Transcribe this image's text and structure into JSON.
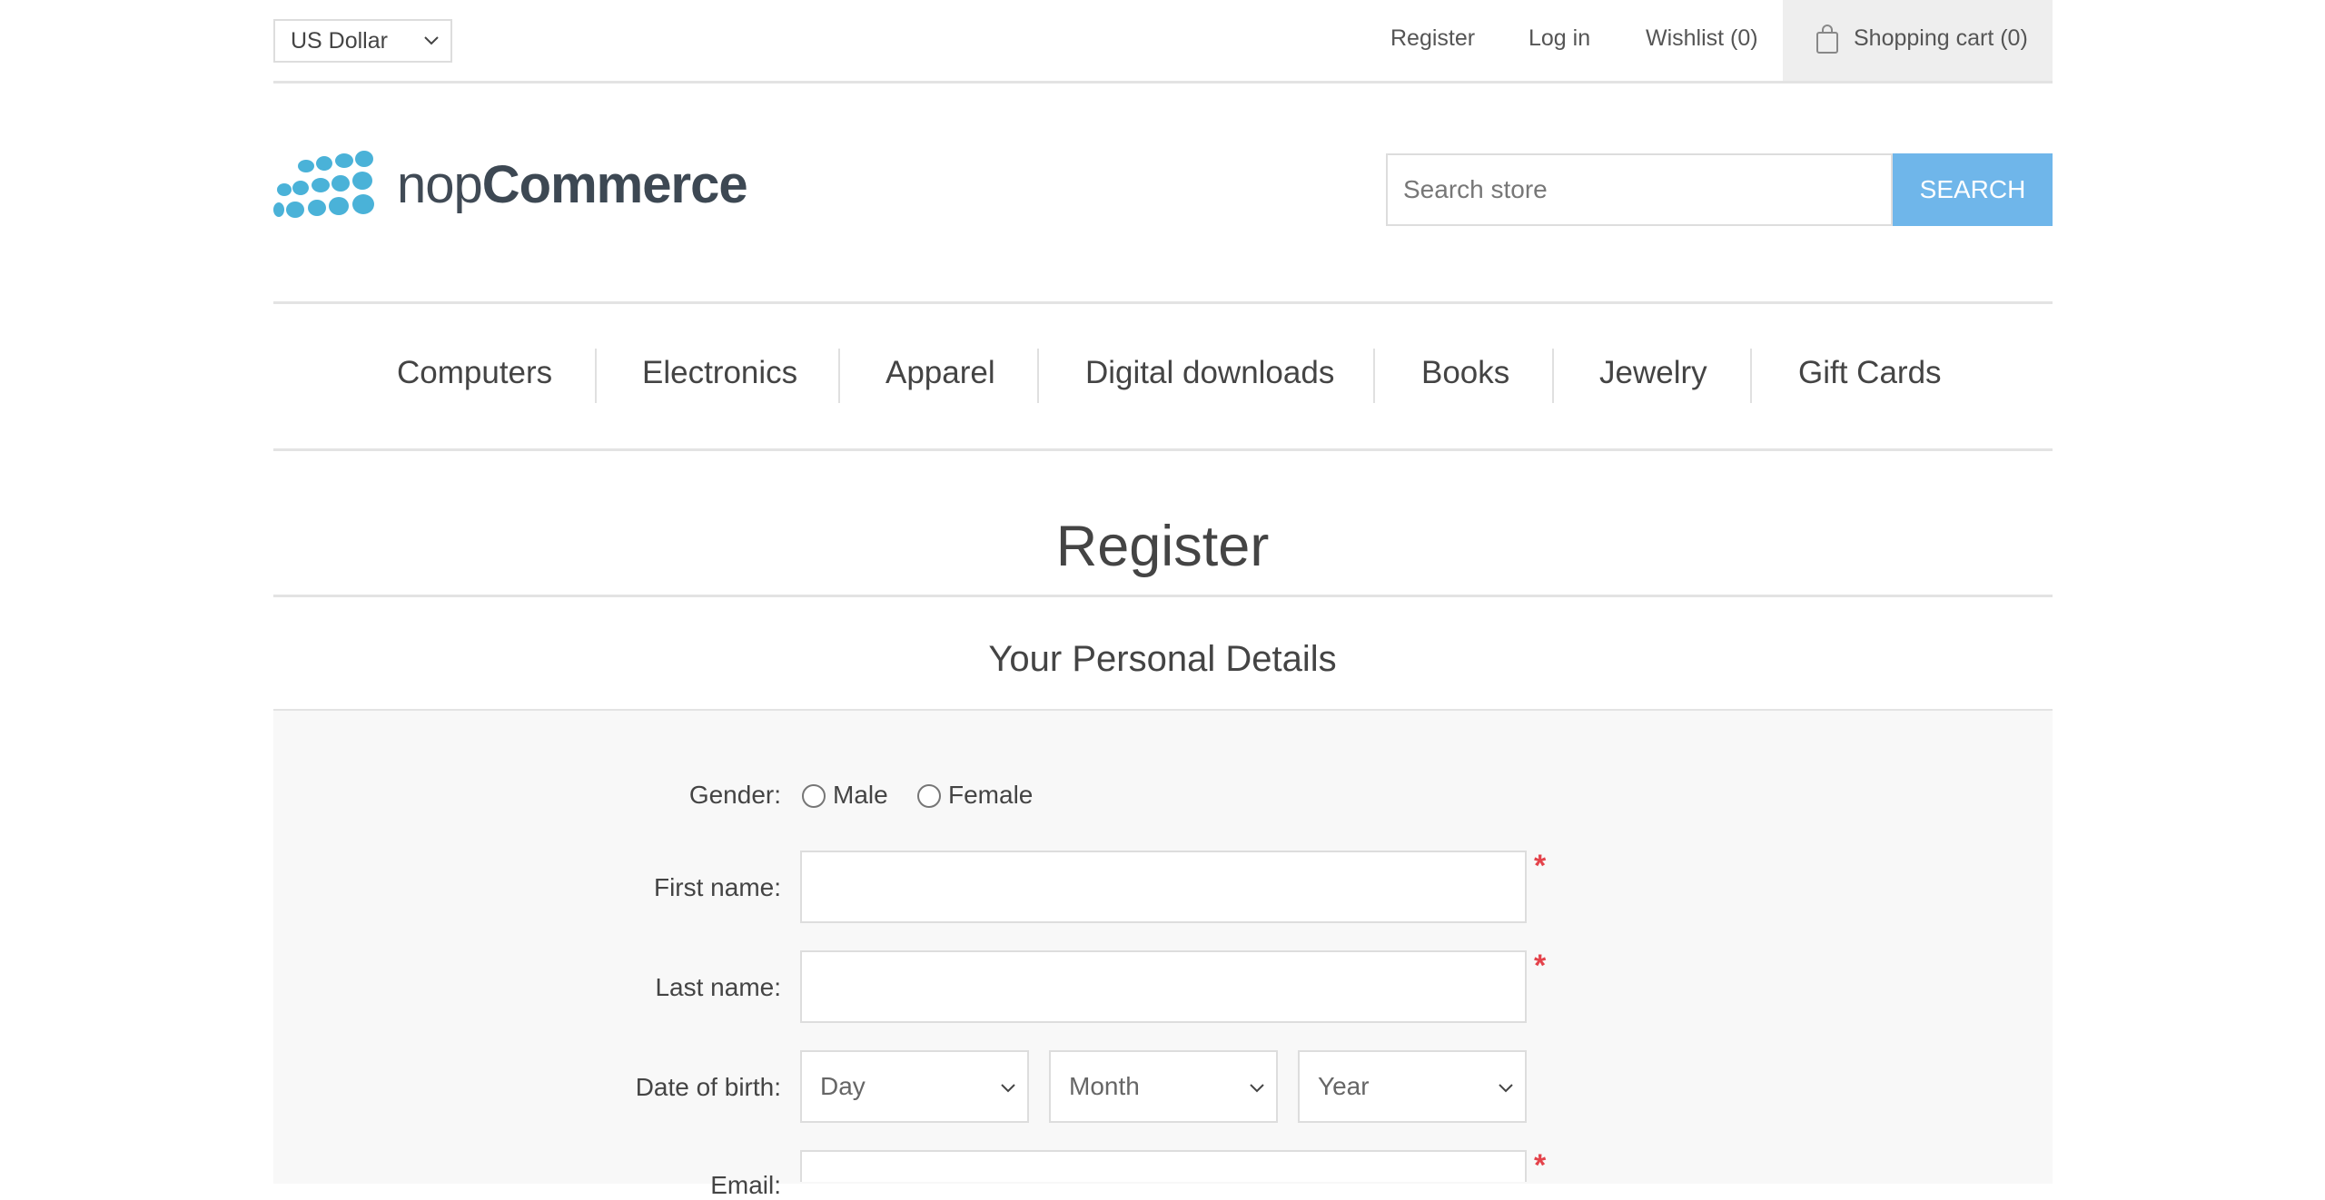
{
  "header": {
    "currency": "US Dollar",
    "links": {
      "register": "Register",
      "login": "Log in",
      "wishlist": "Wishlist (0)",
      "cart": "Shopping cart (0)"
    }
  },
  "logo": {
    "text_light": "nop",
    "text_bold": "Commerce",
    "dot_color": "#4ab2d8"
  },
  "search": {
    "placeholder": "Search store",
    "button": "SEARCH",
    "button_color": "#6fb6ea"
  },
  "nav": {
    "items": [
      "Computers",
      "Electronics",
      "Apparel",
      "Digital downloads",
      "Books",
      "Jewelry",
      "Gift Cards"
    ]
  },
  "page": {
    "title": "Register",
    "section_title": "Your Personal Details"
  },
  "form": {
    "gender_label": "Gender:",
    "gender_options": [
      "Male",
      "Female"
    ],
    "first_name_label": "First name:",
    "last_name_label": "Last name:",
    "dob_label": "Date of birth:",
    "dob_day": "Day",
    "dob_month": "Month",
    "dob_year": "Year",
    "email_label": "Email:",
    "required_mark": "*",
    "required_color": "#e4434b"
  }
}
